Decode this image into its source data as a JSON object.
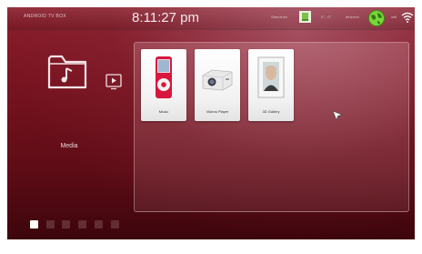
{
  "status_bar": {
    "brand": "ANDROID TV BOX",
    "time": "8:11:27 pm",
    "weather_city": "Shenzhen",
    "weather_temp": "0° - 0°",
    "network_label": "ethernet",
    "wifi_label": "wifi"
  },
  "sidebar": {
    "category_label": "Media"
  },
  "apps": [
    {
      "label": "Music",
      "icon": "music-player-icon"
    },
    {
      "label": "Videos Player",
      "icon": "projector-icon"
    },
    {
      "label": "3D Gallery",
      "icon": "photo-frame-icon"
    }
  ],
  "pager": {
    "pages": 6,
    "active_page": 1
  },
  "colors": {
    "background": "#7a1421",
    "accent": "#ffffff"
  }
}
